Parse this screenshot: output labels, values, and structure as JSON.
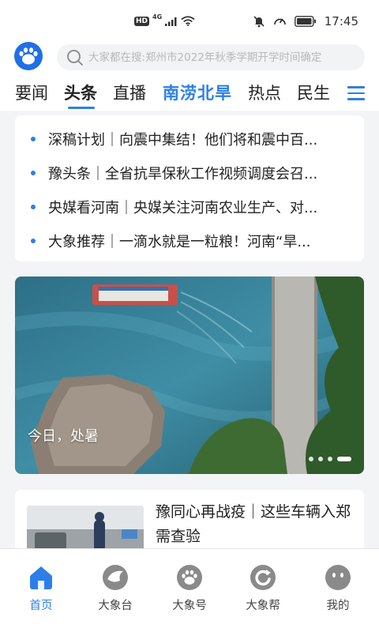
{
  "status_bar": {
    "hd": "HD",
    "network": "4G",
    "time": "17:45"
  },
  "search": {
    "placeholder": "大家都在搜:郑州市2022年秋季学期开学时间确定"
  },
  "tabs": [
    {
      "label": "要闻"
    },
    {
      "label": "头条"
    },
    {
      "label": "直播"
    },
    {
      "label": "南涝北旱"
    },
    {
      "label": "热点"
    },
    {
      "label": "民生"
    }
  ],
  "headlines": [
    {
      "text": "深稿计划｜向震中集结！他们将和震中百..."
    },
    {
      "text": "豫头条｜全省抗旱保秋工作视频调度会召..."
    },
    {
      "text": "央媒看河南｜央媒关注河南农业生产、对..."
    },
    {
      "text": "大象推荐｜一滴水就是一粒粮！河南“旱..."
    }
  ],
  "banner": {
    "caption": "今日，处暑"
  },
  "news_card": {
    "title": "豫同心再战疫｜这些车辆入郑需查验"
  },
  "bottom_nav": [
    {
      "label": "首页"
    },
    {
      "label": "大象台"
    },
    {
      "label": "大象号"
    },
    {
      "label": "大象帮"
    },
    {
      "label": "我的"
    }
  ],
  "colors": {
    "accent": "#2c7fe8",
    "icon_gray": "#8a8a8a"
  }
}
